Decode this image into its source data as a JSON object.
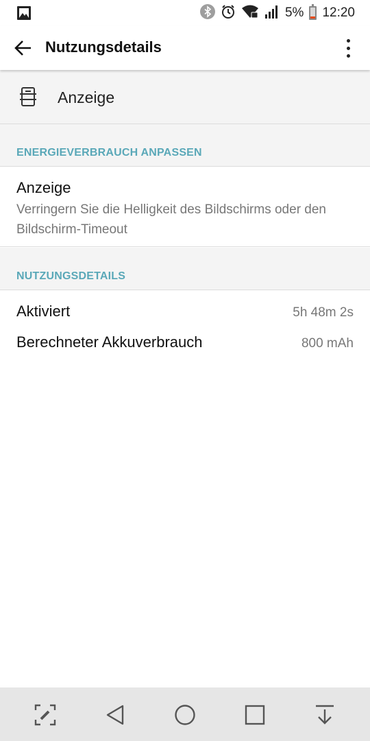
{
  "status_bar": {
    "battery_percent": "5%",
    "time": "12:20",
    "icons": [
      "gallery-icon",
      "bluetooth-icon",
      "alarm-icon",
      "wifi-icon",
      "signal-icon",
      "battery-icon"
    ]
  },
  "app_bar": {
    "title": "Nutzungsdetails",
    "back_icon": "arrow-back-icon",
    "menu_icon": "more-vert-icon"
  },
  "app_header": {
    "icon": "display-icon",
    "name": "Anzeige"
  },
  "section_energy": {
    "header": "ENERGIEVERBRAUCH ANPASSEN",
    "item_title": "Anzeige",
    "item_subtitle": "Verringern Sie die Helligkeit des Bildschirms oder den Bildschirm-Timeout"
  },
  "section_usage": {
    "header": "NUTZUNGSDETAILS",
    "rows": [
      {
        "label": "Aktiviert",
        "value": "5h 48m 2s"
      },
      {
        "label": "Berechneter Akkuverbrauch",
        "value": "800 mAh"
      }
    ]
  },
  "nav_bar": {
    "buttons": [
      "capture-icon",
      "back-triangle-icon",
      "home-circle-icon",
      "recents-square-icon",
      "notification-down-icon"
    ]
  },
  "colors": {
    "accent": "#5aa8b8",
    "battery_low": "#e64a19",
    "section_bg": "#f4f4f4",
    "nav_bg": "#e6e6e6"
  }
}
